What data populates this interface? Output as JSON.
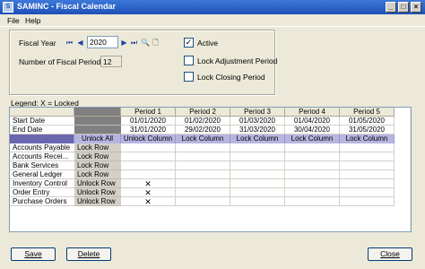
{
  "window": {
    "title": "SAMINC - Fiscal Calendar"
  },
  "menu": {
    "file": "File",
    "help": "Help"
  },
  "form": {
    "fiscal_year_label": "Fiscal Year",
    "fiscal_year_value": "2020",
    "num_periods_label": "Number of Fiscal Periods",
    "num_periods_value": "12",
    "active_label": "Active",
    "active_checked": true,
    "lock_adjustment_label": "Lock Adjustment Period",
    "lock_closing_label": "Lock Closing Period"
  },
  "legend": "Legend: X = Locked",
  "grid": {
    "periods": [
      "Period 1",
      "Period 2",
      "Period 3",
      "Period 4",
      "Period 5"
    ],
    "start_label": "Start Date",
    "end_label": "End Date",
    "start_dates": [
      "01/01/2020",
      "01/02/2020",
      "01/03/2020",
      "01/04/2020",
      "01/05/2020"
    ],
    "end_dates": [
      "31/01/2020",
      "29/02/2020",
      "31/03/2020",
      "30/04/2020",
      "31/05/2020"
    ],
    "unlock_all": "Unlock All",
    "column_actions": [
      "Unlock Column",
      "Lock Column",
      "Lock Column",
      "Lock Column",
      "Lock Column"
    ],
    "rows": [
      {
        "name": "Accounts Payable",
        "action": "Lock Row",
        "locks": [
          "",
          "",
          "",
          "",
          ""
        ]
      },
      {
        "name": "Accounts Recei...",
        "action": "Lock Row",
        "locks": [
          "",
          "",
          "",
          "",
          ""
        ]
      },
      {
        "name": "Bank Services",
        "action": "Lock Row",
        "locks": [
          "",
          "",
          "",
          "",
          ""
        ]
      },
      {
        "name": "General Ledger",
        "action": "Lock Row",
        "locks": [
          "",
          "",
          "",
          "",
          ""
        ]
      },
      {
        "name": "Inventory Control",
        "action": "Unlock Row",
        "locks": [
          "X",
          "",
          "",
          "",
          ""
        ]
      },
      {
        "name": "Order Entry",
        "action": "Unlock Row",
        "locks": [
          "X",
          "",
          "",
          "",
          ""
        ]
      },
      {
        "name": "Purchase Orders",
        "action": "Unlock Row",
        "locks": [
          "X",
          "",
          "",
          "",
          ""
        ]
      }
    ]
  },
  "buttons": {
    "save": "Save",
    "delete": "Delete",
    "close": "Close"
  }
}
